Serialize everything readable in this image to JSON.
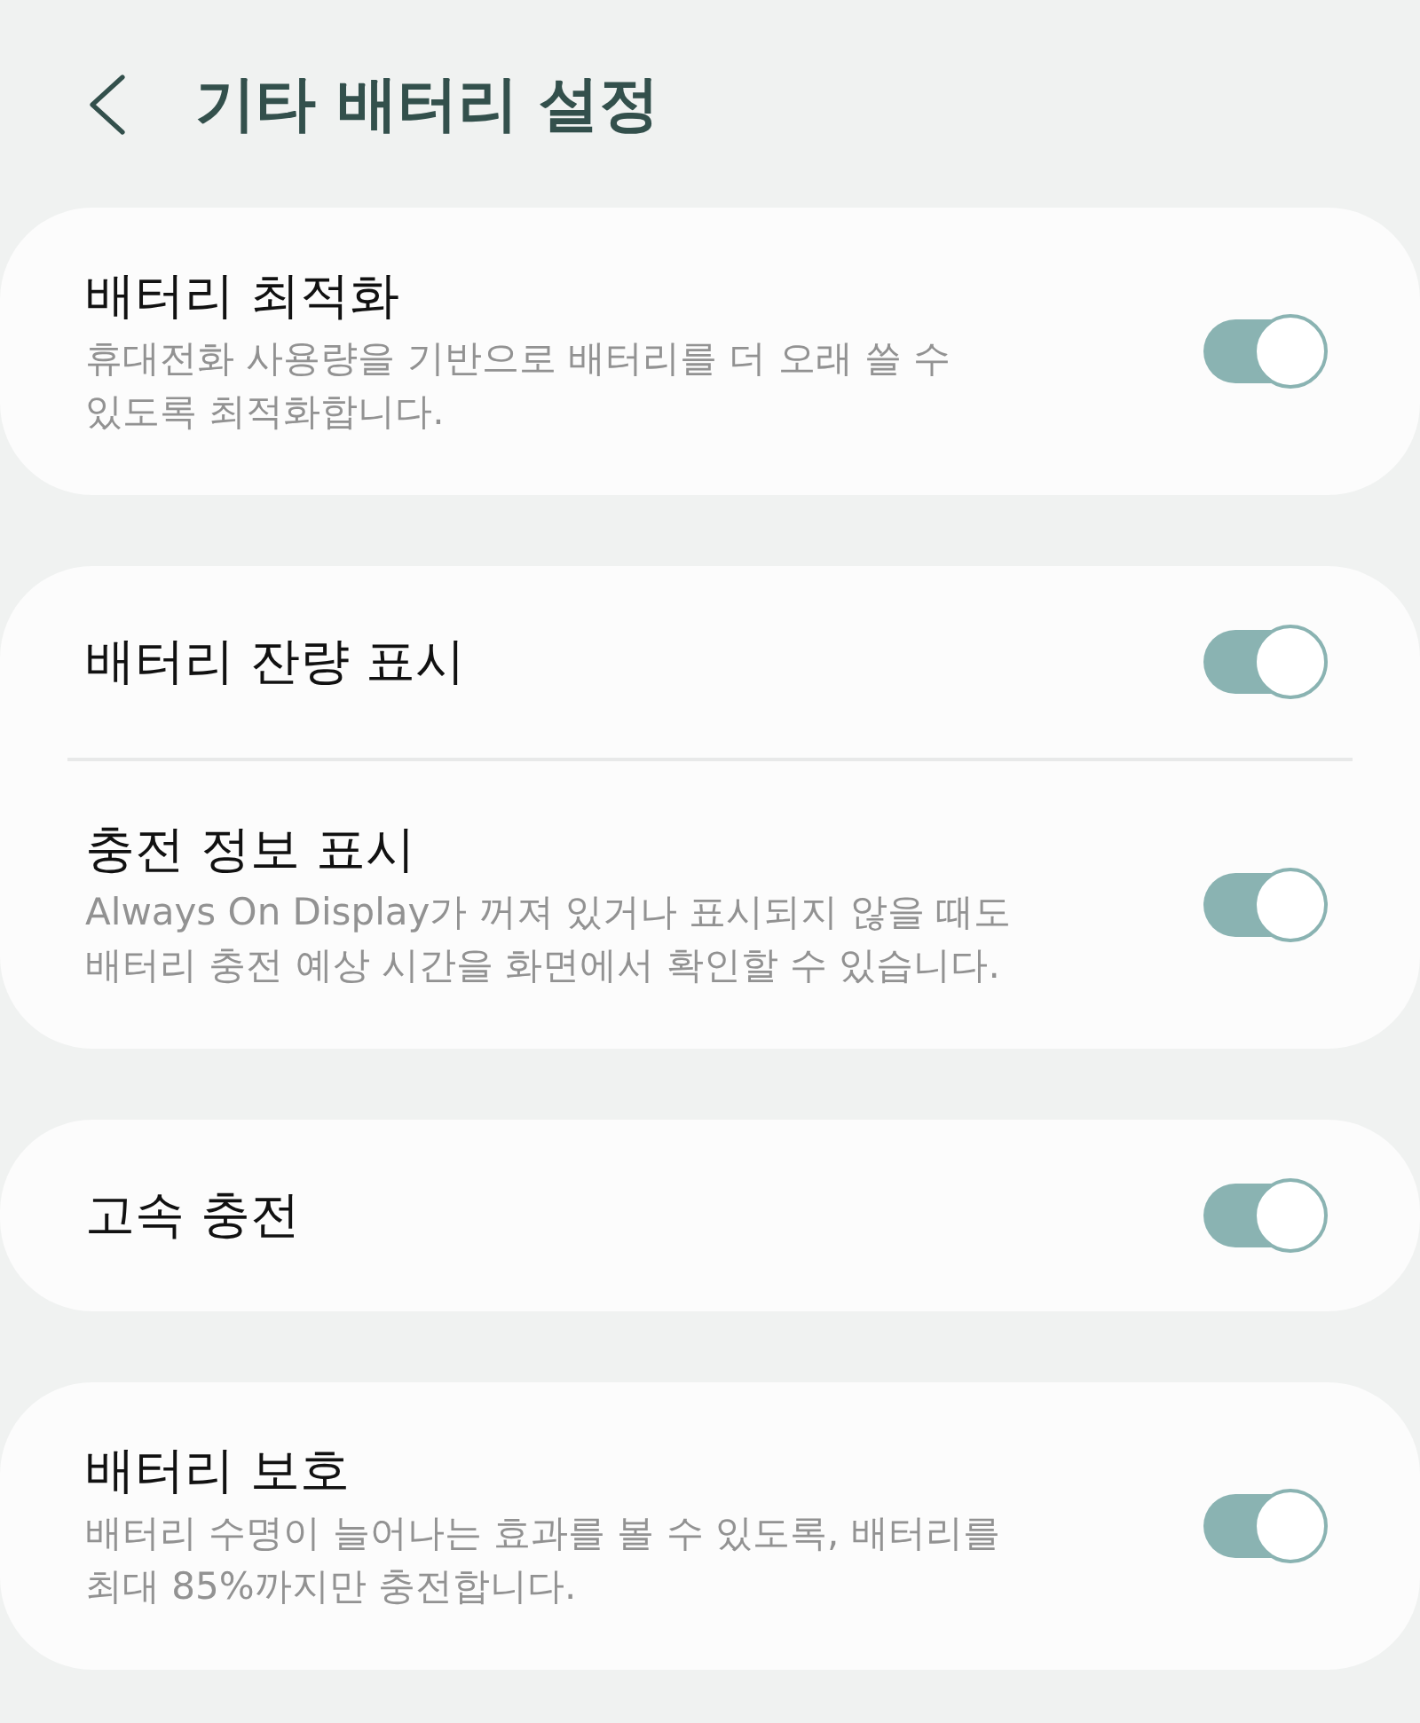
{
  "header": {
    "title": "기타 배터리 설정"
  },
  "groups": [
    {
      "items": [
        {
          "title": "배터리 최적화",
          "description": "휴대전화 사용량을 기반으로 배터리를 더 오래 쓸 수 있도록 최적화합니다.",
          "on": true
        }
      ]
    },
    {
      "items": [
        {
          "title": "배터리 잔량 표시",
          "on": true
        },
        {
          "title": "충전 정보 표시",
          "description": "Always On Display가 꺼져 있거나 표시되지 않을 때도 배터리 충전 예상 시간을 화면에서 확인할 수 있습니다.",
          "on": true
        }
      ]
    },
    {
      "items": [
        {
          "title": "고속 충전",
          "on": true
        }
      ]
    },
    {
      "items": [
        {
          "title": "배터리 보호",
          "description": "배터리 수명이 늘어나는 효과를 볼 수 있도록, 배터리를 최대 85%까지만 충전합니다.",
          "on": true
        }
      ]
    }
  ]
}
